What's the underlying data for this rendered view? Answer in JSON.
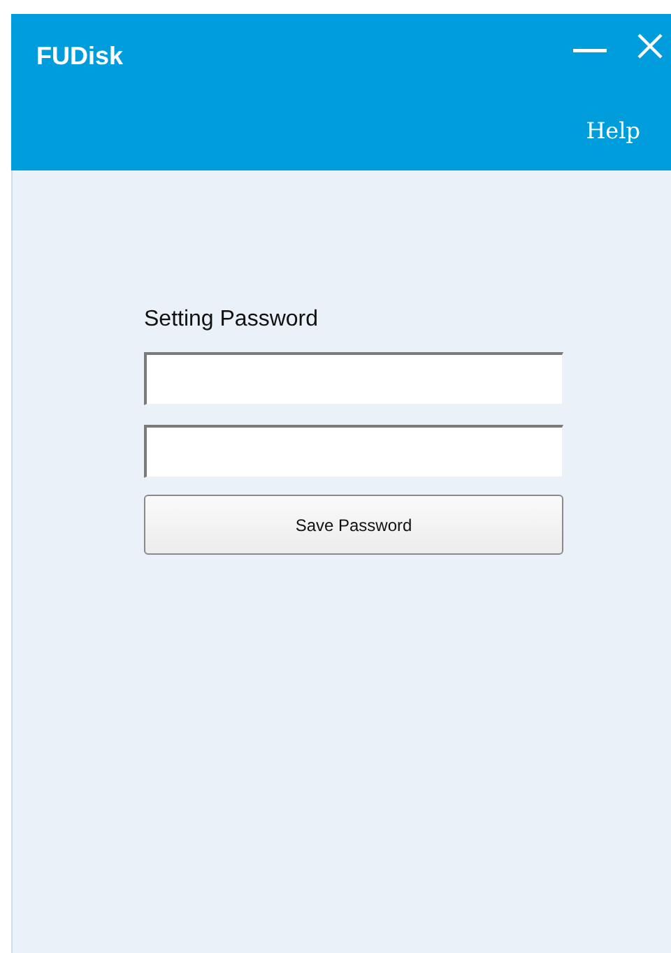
{
  "window": {
    "title": "FUDisk"
  },
  "header": {
    "help_link": "Help"
  },
  "form": {
    "heading": "Setting Password",
    "fields": [
      {
        "kind": "password"
      },
      {
        "kind": "password"
      }
    ],
    "save_button": "Save Password"
  }
}
